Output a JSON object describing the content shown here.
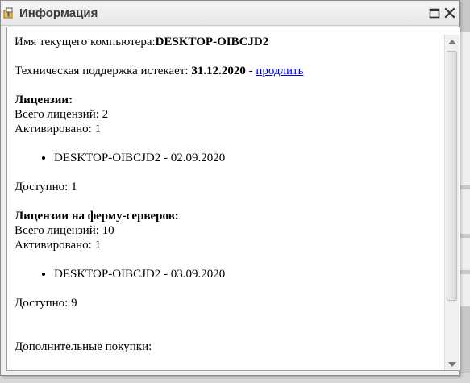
{
  "window": {
    "title": "Информация",
    "app_icon": "info-app-icon",
    "buttons": [
      "maximize-icon",
      "close-icon"
    ]
  },
  "content": {
    "computer_label": "Имя текущего компьютера:",
    "computer_name": "DESKTOP-OIBCJD2",
    "support_label": "Техническая поддержка истекает: ",
    "support_date": "31.12.2020",
    "support_sep": " - ",
    "extend_link": "продлить",
    "licenses": {
      "heading": "Лицензии:",
      "total": "Всего лицензий: 2",
      "activated": "Активировано: 1",
      "items": [
        "DESKTOP-OIBCJD2 - 02.09.2020"
      ],
      "available": "Доступно: 1"
    },
    "server_licenses": {
      "heading": "Лицензии на ферму-серверов:",
      "total": "Всего лицензий: 10",
      "activated": "Активировано: 1",
      "items": [
        "DESKTOP-OIBCJD2 - 03.09.2020"
      ],
      "available": "Доступно: 9"
    },
    "extra_purchases": "Дополнительные покупки:"
  }
}
